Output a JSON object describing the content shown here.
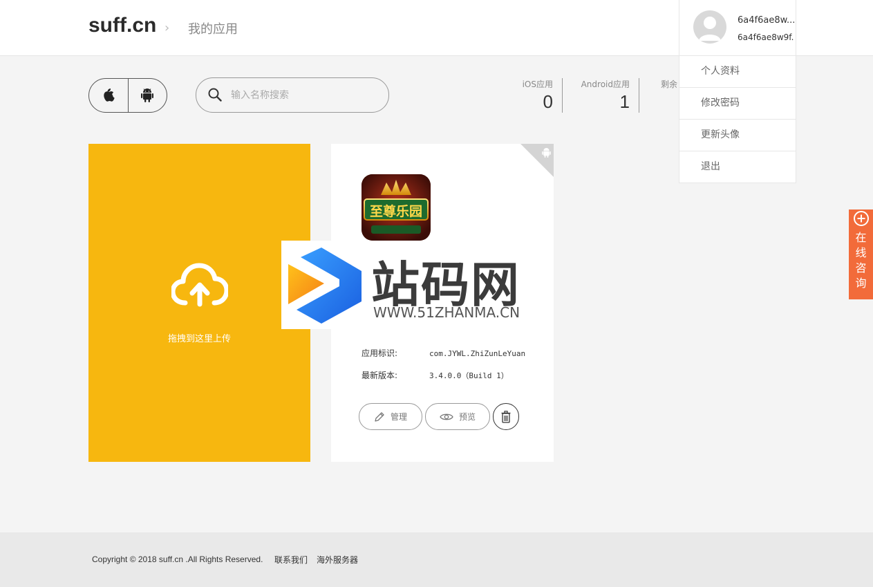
{
  "header": {
    "logo": "suff.cn",
    "breadcrumb_sep": "›",
    "breadcrumb": "我的应用"
  },
  "user": {
    "name_line1": "6a4f6ae8w...",
    "name_line2": "6a4f6ae8w9f...",
    "menu": [
      "个人资料",
      "修改密码",
      "更新头像",
      "退出"
    ]
  },
  "toolbar": {
    "search_placeholder": "输入名称搜索",
    "ios_icon": "apple-icon",
    "android_icon": "android-icon"
  },
  "stats": {
    "ios_label": "iOS应用",
    "ios_value": "0",
    "android_label": "Android应用",
    "android_value": "1",
    "remaining_label": "剩余"
  },
  "upload": {
    "label": "拖拽到这里上传",
    "icon": "cloud-upload-icon"
  },
  "app": {
    "icon_text": "至尊乐园",
    "bundle_label": "应用标识:",
    "bundle_value": "com.JYWL.ZhiZunLeYuan",
    "version_label": "最新版本:",
    "version_value": "3.4.0.0（Build 1）",
    "manage_label": "管理",
    "preview_label": "预览"
  },
  "watermark": {
    "text": "站码网",
    "url": "WWW.51ZHANMA.CN"
  },
  "consult": {
    "text": "在线咨询"
  },
  "footer": {
    "copyright": "Copyright © 2018 suff.cn .All Rights Reserved.",
    "contact": "联系我们",
    "overseas": "海外服务器"
  },
  "colors": {
    "upload_bg": "#f7b70f",
    "consult_bg": "#f26b3a",
    "watermark_blue": "#2f7bf0",
    "watermark_orange": "#f7a21b"
  }
}
